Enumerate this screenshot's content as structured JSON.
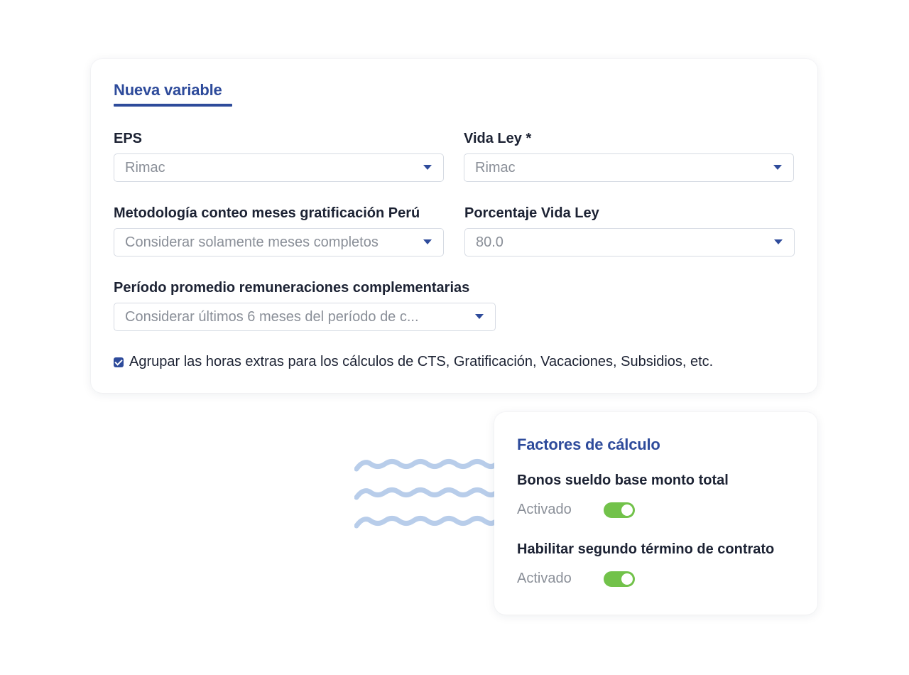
{
  "variable_card": {
    "title": "Nueva variable",
    "fields": [
      {
        "label": "EPS",
        "value": "Rimac"
      },
      {
        "label": "Vida Ley *",
        "value": "Rimac"
      },
      {
        "label": "Metodología conteo meses gratificación Perú",
        "value": "Considerar solamente meses completos"
      },
      {
        "label": "Porcentaje Vida Ley",
        "value": "80.0"
      },
      {
        "label": "Período promedio remuneraciones complementarias",
        "value": "Considerar últimos 6 meses del período de c..."
      }
    ],
    "checkbox": {
      "checked": true,
      "label": "Agrupar las horas extras para los cálculos de CTS, Gratificación, Vacaciones, Subsidios, etc."
    }
  },
  "factors_card": {
    "title": "Factores de cálculo",
    "items": [
      {
        "label": "Bonos sueldo base monto total",
        "status": "Activado",
        "enabled": true
      },
      {
        "label": "Habilitar segundo término de contrato",
        "status": "Activado",
        "enabled": true
      }
    ]
  },
  "colors": {
    "accent": "#2e4b9b",
    "heading_text": "#1c2233",
    "muted_text": "#8a8f98",
    "toggle_on": "#72c24a",
    "decorative_waves": "#b8cdea"
  },
  "icons": {
    "dropdown": "caret-down-icon",
    "checkbox": "checkmark-icon",
    "decoration": "waves-decoration"
  }
}
